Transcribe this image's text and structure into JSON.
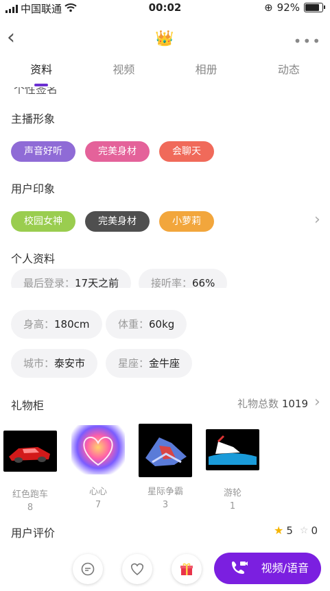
{
  "status_bar": {
    "carrier": "中国联通",
    "time": "00:02",
    "battery": "92%",
    "battery_level": 0.92
  },
  "nav": {
    "back": "‹",
    "crown": "👑",
    "more": "•••"
  },
  "tabs": [
    {
      "label": "资料"
    },
    {
      "label": "视频"
    },
    {
      "label": "相册"
    },
    {
      "label": "动态"
    }
  ],
  "cut_text": "个性签名",
  "host_image": {
    "title": "主播形象",
    "tags": [
      {
        "label": "声音好听",
        "color": "#8f6bd6"
      },
      {
        "label": "完美身材",
        "color": "#e4629a"
      },
      {
        "label": "会聊天",
        "color": "#f06a5a"
      }
    ]
  },
  "user_impression": {
    "title": "用户印象",
    "tags": [
      {
        "label": "校园女神",
        "color": "#9acd4f"
      },
      {
        "label": "完美身材",
        "color": "#4f4f4f"
      },
      {
        "label": "小萝莉",
        "color": "#f2a63c"
      }
    ]
  },
  "profile": {
    "title": "个人资料",
    "items": [
      {
        "key": "最后登录：",
        "value": "17天之前"
      },
      {
        "key": "接听率：",
        "value": "66%"
      },
      {
        "key": "身高：",
        "value": "180cm"
      },
      {
        "key": "体重：",
        "value": "60kg"
      },
      {
        "key": "城市：",
        "value": "泰安市"
      },
      {
        "key": "星座：",
        "value": "金牛座"
      }
    ]
  },
  "gifts": {
    "title": "礼物柜",
    "total_label": "礼物总数",
    "total": "1019",
    "items": [
      {
        "name": "红色跑车",
        "count": "8"
      },
      {
        "name": "心心",
        "count": "7"
      },
      {
        "name": "星际争霸",
        "count": "3"
      },
      {
        "name": "游轮",
        "count": "1"
      }
    ]
  },
  "reviews": {
    "title": "用户评价",
    "good": "5",
    "bad": "0"
  },
  "bottom": {
    "cta_label": "视频/语音"
  }
}
